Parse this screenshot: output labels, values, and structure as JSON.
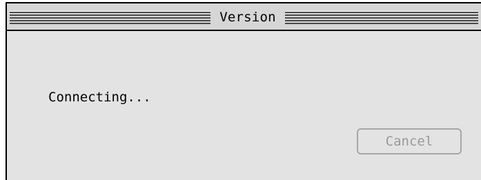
{
  "window": {
    "title": "Version"
  },
  "dialog": {
    "message": "Connecting...",
    "cancel_label": "Cancel",
    "cancel_enabled": false
  },
  "colors": {
    "background": "#e3e3e3",
    "titlebar": "#d6d6d6",
    "disabled_text": "#9a9a9a",
    "disabled_border": "#a6a6a6"
  }
}
